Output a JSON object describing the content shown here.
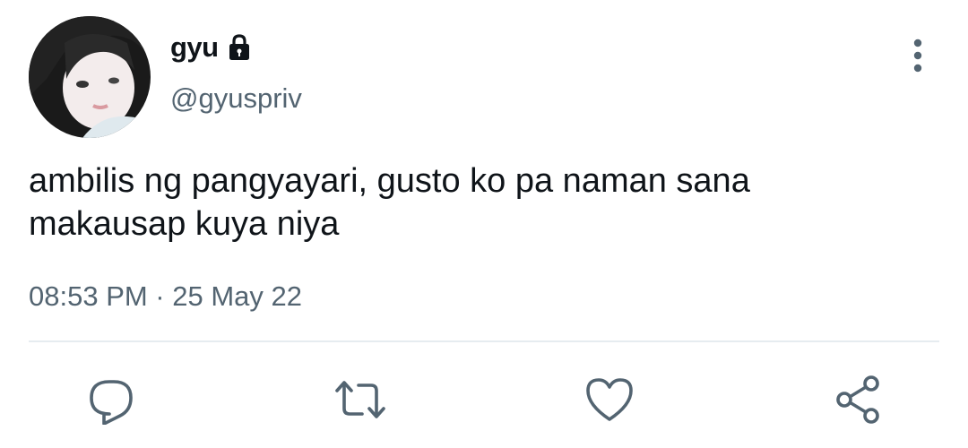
{
  "tweet": {
    "author": {
      "display_name": "gyu",
      "handle": "@gyuspriv",
      "protected_icon": "lock-icon"
    },
    "text": "ambilis ng pangyayari, gusto ko pa naman sana\nmakausap kuya niya",
    "timestamp": "08:53 PM · 25 May 22",
    "actions": [
      {
        "name": "reply",
        "icon": "reply-icon"
      },
      {
        "name": "retweet",
        "icon": "retweet-icon"
      },
      {
        "name": "like",
        "icon": "heart-icon"
      },
      {
        "name": "share",
        "icon": "share-icon"
      }
    ],
    "menu_icon": "more-vertical-icon"
  },
  "colors": {
    "text_primary": "#0f1419",
    "text_secondary": "#536471",
    "icon": "#536471",
    "divider": "#e6ecf0"
  }
}
